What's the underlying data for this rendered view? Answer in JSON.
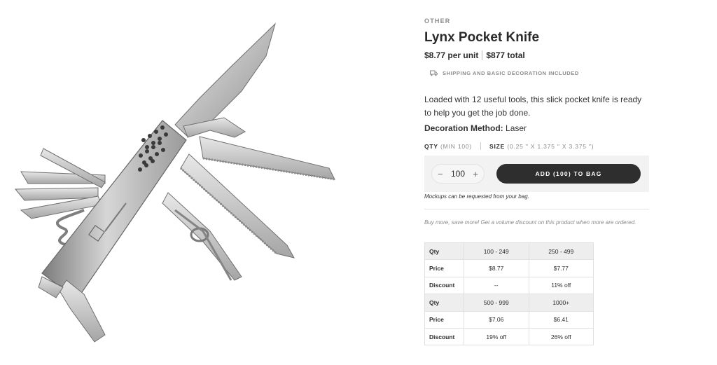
{
  "product": {
    "category": "OTHER",
    "name": "Lynx Pocket Knife",
    "unit_price": "$8.77 per unit",
    "total_price": "$877 total",
    "shipping": "SHIPPING AND BASIC DECORATION INCLUDED",
    "description": "Loaded with 12 useful tools, this slick pocket knife is ready to help you get the job done.",
    "decoration_label": "Decoration Method:",
    "decoration_value": "Laser"
  },
  "options": {
    "qty_label": "QTY",
    "qty_min": "(MIN 100)",
    "size_label": "SIZE",
    "size_value": "(0.25 \" X 1.375 \" X 3.375 \")"
  },
  "cart": {
    "minus": "−",
    "quantity": "100",
    "plus": "+",
    "add_button": "ADD (100) TO BAG"
  },
  "mockup_note": "Mockups can be requested from your bag.",
  "promo": "Buy more, save more! Get a volume discount on this product when more are ordered.",
  "pricing_table": {
    "rows": [
      {
        "label": "Qty",
        "a": "100 - 249",
        "b": "250 - 499",
        "type": "qty"
      },
      {
        "label": "Price",
        "a": "$8.77",
        "b": "$7.77",
        "type": "price"
      },
      {
        "label": "Discount",
        "a": "--",
        "b": "11% off",
        "type": "discount"
      },
      {
        "label": "Qty",
        "a": "500 - 999",
        "b": "1000+",
        "type": "qty"
      },
      {
        "label": "Price",
        "a": "$7.06",
        "b": "$6.41",
        "type": "price"
      },
      {
        "label": "Discount",
        "a": "19% off",
        "b": "26% off",
        "type": "discount"
      }
    ]
  },
  "icons": {
    "shipping": "truck-icon"
  }
}
